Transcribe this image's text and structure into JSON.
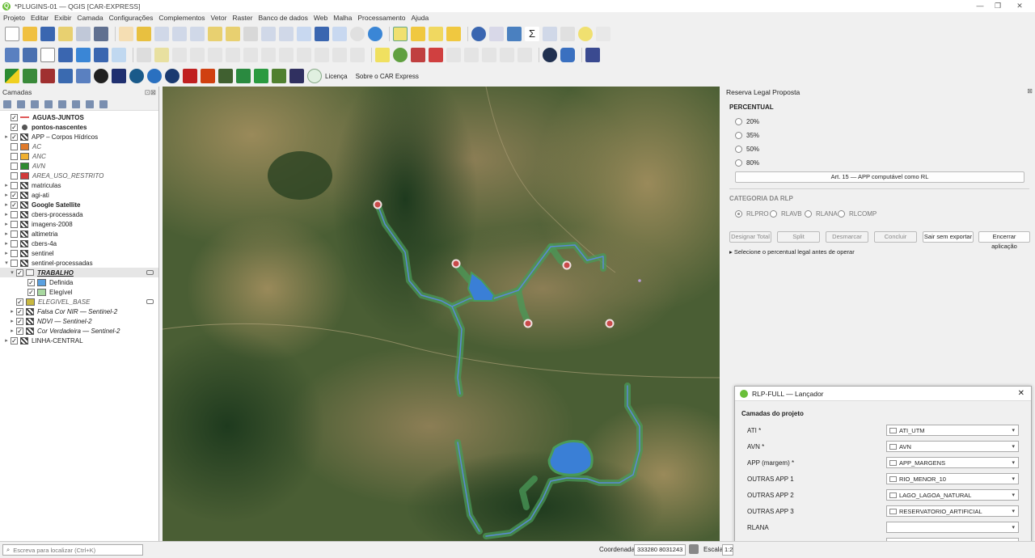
{
  "window": {
    "title": "*PLUGINS-01 — QGIS [CAR-EXPRESS]",
    "logo_letter": "Q"
  },
  "menu": [
    "Projeto",
    "Editar",
    "Exibir",
    "Camada",
    "Configurações",
    "Complementos",
    "Vetor",
    "Raster",
    "Banco de dados",
    "Web",
    "Malha",
    "Processamento",
    "Ajuda"
  ],
  "toolbar3": {
    "license_label": "Licença",
    "about_label": "Sobre o CAR Express"
  },
  "layers_panel": {
    "title": "Camadas",
    "layers": [
      {
        "name": "AGUAS-JUNTOS",
        "checked": true,
        "bold": true,
        "arrow": "",
        "icon": "line",
        "color": "#e05a5a"
      },
      {
        "name": "pontos-nascentes",
        "checked": true,
        "bold": true,
        "arrow": "",
        "icon": "point",
        "color": "#555555"
      },
      {
        "name": "APP – Corpos Hídricos",
        "checked": true,
        "arrow": "▸",
        "icon": "raster"
      },
      {
        "name": "AC",
        "checked": false,
        "italic": true,
        "arrow": "",
        "icon": "swatch",
        "color": "#e07a2a"
      },
      {
        "name": "ANC",
        "checked": false,
        "italic": true,
        "arrow": "",
        "icon": "swatch",
        "color": "#f0b030"
      },
      {
        "name": "AVN",
        "checked": false,
        "italic": true,
        "arrow": "",
        "icon": "swatch",
        "color": "#2e8a30"
      },
      {
        "name": "AREA_USO_RESTRITO",
        "checked": false,
        "italic": true,
        "arrow": "",
        "icon": "swatch",
        "color": "#d23a3a"
      },
      {
        "name": "matriculas",
        "checked": false,
        "arrow": "▸",
        "icon": "raster"
      },
      {
        "name": "agi-ati",
        "checked": true,
        "arrow": "▸",
        "icon": "raster"
      },
      {
        "name": "Google Satellite",
        "checked": true,
        "bold": true,
        "arrow": "▸",
        "icon": "raster"
      },
      {
        "name": "cbers-processada",
        "checked": false,
        "arrow": "▸",
        "icon": "raster"
      },
      {
        "name": "imagens-2008",
        "checked": false,
        "arrow": "▸",
        "icon": "raster"
      },
      {
        "name": "altimetria",
        "checked": false,
        "arrow": "▸",
        "icon": "raster"
      },
      {
        "name": "cbers-4a",
        "checked": false,
        "arrow": "▸",
        "icon": "raster"
      },
      {
        "name": "sentinel",
        "checked": false,
        "arrow": "▸",
        "icon": "raster"
      },
      {
        "name": "sentinel-processadas",
        "checked": false,
        "arrow": "▾",
        "icon": "raster"
      },
      {
        "name": "TRABALHO",
        "checked": true,
        "italic": true,
        "bold": true,
        "underline": true,
        "arrow": "▾",
        "icon": "group",
        "indent": 1,
        "selected": true
      },
      {
        "name": "Definida",
        "checked": true,
        "arrow": "",
        "icon": "swatch",
        "color": "#5aa0e0",
        "indent": 3
      },
      {
        "name": "Elegível",
        "checked": true,
        "arrow": "",
        "icon": "swatch",
        "color": "#a8d8a0",
        "indent": 3
      },
      {
        "name": "ELEGIVEL_BASE",
        "checked": true,
        "italic": true,
        "arrow": "",
        "icon": "swatch",
        "color": "#c8b840",
        "indent": 1
      },
      {
        "name": "Falsa Cor NIR — Sentinel-2",
        "checked": true,
        "italic": true,
        "arrow": "▸",
        "icon": "raster",
        "indent": 1
      },
      {
        "name": "NDVI — Sentinel-2",
        "checked": true,
        "italic": true,
        "arrow": "▸",
        "icon": "raster",
        "indent": 1
      },
      {
        "name": "Cor Verdadeira — Sentinel-2",
        "checked": true,
        "italic": true,
        "arrow": "▸",
        "icon": "raster",
        "indent": 1
      },
      {
        "name": "LINHA-CENTRAL",
        "checked": true,
        "arrow": "▸",
        "icon": "raster"
      }
    ]
  },
  "rl_panel": {
    "title": "Reserva Legal Proposta",
    "percent_title": "PERCENTUAL",
    "percent_options": [
      "20%",
      "35%",
      "50%",
      "80%"
    ],
    "art_button": "Art. 15 — APP computável como RL",
    "category_title": "CATEGORIA DA RLP",
    "categories": [
      "RLPRO",
      "RLAVB",
      "RLANA",
      "RLCOMP"
    ],
    "buttons": {
      "designar": "Designar Total",
      "split": "Split",
      "desmarcar": "Desmarcar",
      "concluir": "Concluir",
      "sair": "Sair sem exportar",
      "encerrar": "Encerrar aplicação"
    },
    "hint": "▸ Selecione o percentual legal antes de operar"
  },
  "launcher": {
    "title": "RLP-FULL — Lançador",
    "section": "Camadas do projeto",
    "rows": [
      {
        "label": "ATI *",
        "value": "ATI_UTM"
      },
      {
        "label": "AVN *",
        "value": "AVN"
      },
      {
        "label": "APP (margem) *",
        "value": "APP_MARGENS"
      },
      {
        "label": "OUTRAS APP 1",
        "value": "RIO_MENOR_10"
      },
      {
        "label": "OUTRAS APP 2",
        "value": "LAGO_LAGOA_NATURAL"
      },
      {
        "label": "OUTRAS APP 3",
        "value": "RESERVATORIO_ARTIFICIAL"
      },
      {
        "label": "RLANA",
        "value": ""
      },
      {
        "label": "RLAVB",
        "value": ""
      }
    ]
  },
  "status": {
    "locator_placeholder": "Escreva para localizar (Ctrl+K)",
    "coord_label": "Coordenada",
    "coord_value": "333280  8031243",
    "scale_label": "Escala",
    "scale_value": "1:2"
  },
  "colors": {
    "water": "#3a7fd6",
    "app_buffer": "#4a9a58",
    "spring": "#c84a4a"
  }
}
